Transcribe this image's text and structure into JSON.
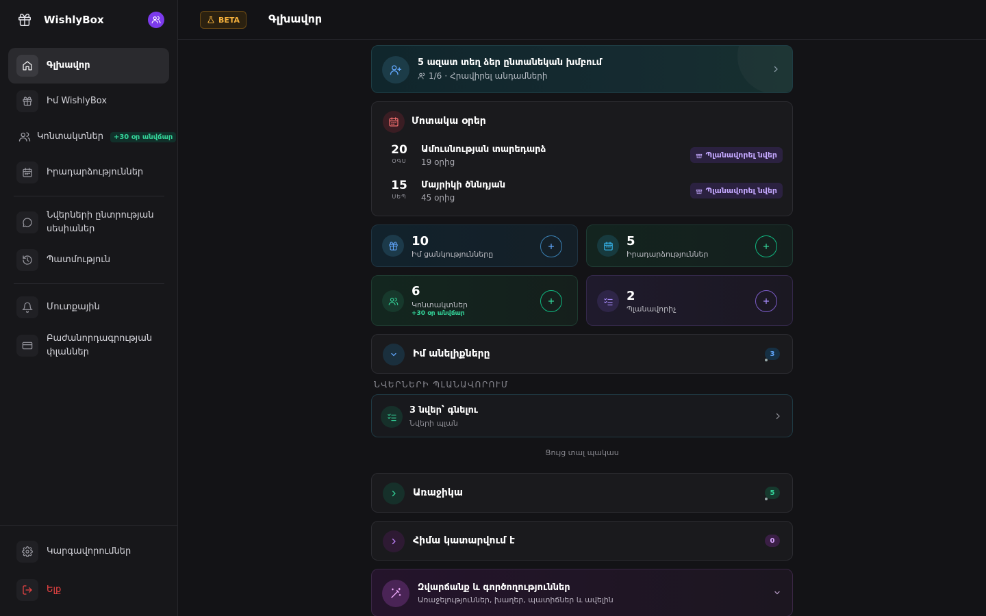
{
  "app": {
    "name": "WishlyBox"
  },
  "sidebar": {
    "items": [
      {
        "label": "Գլխավոր"
      },
      {
        "label": "Իմ WishlyBox"
      },
      {
        "label": "Կոնտակտներ",
        "badge": "+30 օր անվճար"
      },
      {
        "label": "Իրադարձություններ"
      },
      {
        "label": "Նվերների ընտրության սեսիաներ"
      },
      {
        "label": "Պատմություն"
      },
      {
        "label": "Մուտքային"
      },
      {
        "label": "Բաժանորդագրության փլաններ"
      }
    ],
    "settings": "Կարգավորումներ",
    "logout": "Ելք"
  },
  "header": {
    "beta": "BETA",
    "title": "Գլխավոր"
  },
  "invite": {
    "title": "5 ազատ տեղ ձեր ընտանեկան խմբում",
    "count": "1/6",
    "action": "Հրավիրել անդամների"
  },
  "upcoming": {
    "title": "Մոտակա օրեր",
    "events": [
      {
        "day": "20",
        "month": "ՕԳՍ",
        "name": "Ամուսնության տարեդարձ",
        "in": "19 օրից",
        "action": "Պլանավորել նվեր"
      },
      {
        "day": "15",
        "month": "ՍԵՊ",
        "name": "Մայրիկի ծննդյան",
        "in": "45 օրից",
        "action": "Պլանավորել նվեր"
      }
    ]
  },
  "stats": {
    "wishlists": {
      "value": "10",
      "label": "Իմ ցանկությունները"
    },
    "events": {
      "value": "5",
      "label": "Իրադարձություններ"
    },
    "contacts": {
      "value": "6",
      "label": "Կոնտակտներ",
      "extra": "+30 օր անվճար"
    },
    "planners": {
      "value": "2",
      "label": "Պլանավորիչ"
    }
  },
  "my_wishes": {
    "title": "Իմ անելիքները",
    "count": "3"
  },
  "gift_planning": {
    "section": "ՆՎԵՐՆԵՐԻ ՊԼԱՆԱՎՈՐՈՒՄ",
    "title": "3 նվեր՝ գնելու",
    "sub": "Նվերի պլան",
    "show_less": "Ցույց տալ պակաս"
  },
  "upcoming_list": {
    "title": "Առաջիկա",
    "count": "5"
  },
  "in_progress": {
    "title": "Հիմա կատարվում է",
    "count": "0"
  },
  "fun": {
    "title": "Զվարճանք և գործողություններ",
    "sub": "Առաջելություններ, խաղեր, պատիճներ և ավելին"
  },
  "colors": {
    "accent_purple": "#7c3aed",
    "accent_green": "#34d399",
    "danger": "#ef4444",
    "beta": "#f5b13d"
  }
}
